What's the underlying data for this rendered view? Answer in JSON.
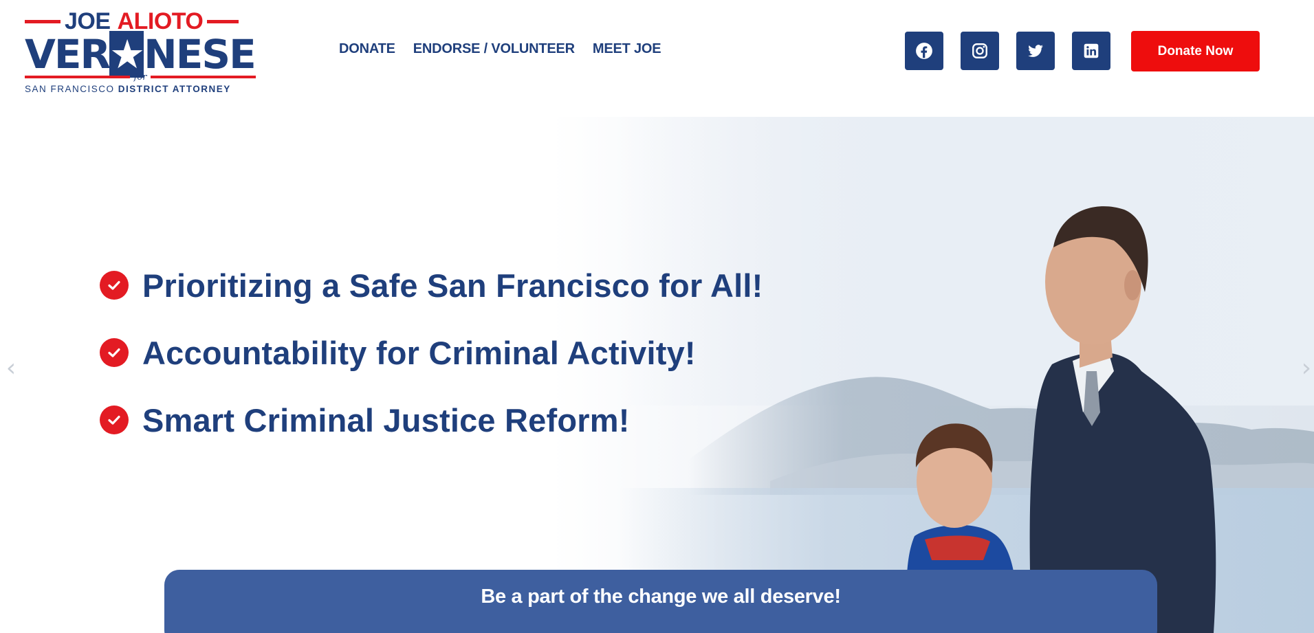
{
  "logo": {
    "joe": "JOE",
    "alioto": "ALIOTO",
    "veronese_pre": "VER",
    "veronese_star": "★",
    "veronese_post": "NESE",
    "for": "for",
    "subtitle_plain": "SAN FRANCISCO ",
    "subtitle_bold": "DISTRICT ATTORNEY"
  },
  "nav": {
    "items": [
      {
        "label": "DONATE"
      },
      {
        "label": "ENDORSE / VOLUNTEER"
      },
      {
        "label": "MEET JOE"
      }
    ]
  },
  "socials": [
    {
      "icon": "facebook-icon"
    },
    {
      "icon": "instagram-icon"
    },
    {
      "icon": "twitter-icon"
    },
    {
      "icon": "linkedin-icon"
    }
  ],
  "header": {
    "donate_now_label": "Donate Now"
  },
  "hero": {
    "bullets": [
      {
        "text": "Prioritizing a Safe San Francisco for All!"
      },
      {
        "text": "Accountability for Criminal Activity!"
      },
      {
        "text": "Smart Criminal Justice Reform!"
      }
    ],
    "prev_arrow": "‹",
    "next_arrow": "›",
    "cta_text": "Be a part of the change we all deserve!"
  },
  "colors": {
    "brand_blue": "#1f3f7c",
    "brand_red": "#e31b23",
    "donate_red": "#ee0d0d",
    "cta_blue": "#3e5f9f"
  }
}
